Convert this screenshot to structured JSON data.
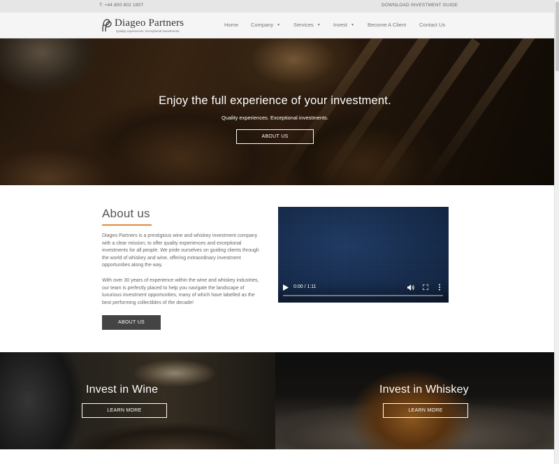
{
  "topbar": {
    "phone": "T: +44 800 802 1907",
    "guide_link": "DOWNLOAD INVESTMENT GUIDE"
  },
  "header": {
    "logo_name": "Diageo Partners",
    "logo_tagline": "Quality experiences. Exceptional investments.",
    "nav": [
      {
        "label": "Home",
        "has_dropdown": false
      },
      {
        "label": "Company",
        "has_dropdown": true
      },
      {
        "label": "Services",
        "has_dropdown": true
      },
      {
        "label": "Invest",
        "has_dropdown": true
      },
      {
        "label": "Become A Client",
        "has_dropdown": false
      },
      {
        "label": "Contact Us",
        "has_dropdown": false
      }
    ],
    "caret": "▼"
  },
  "hero": {
    "title": "Enjoy the full experience of your investment.",
    "subtitle": "Quality experiences. Exceptional investments.",
    "button": "ABOUT US"
  },
  "about": {
    "title": "About us",
    "paragraph1": "Diageo Partners is a prestigious wine and whiskey investment company with a clear mission; to offer quality experiences and exceptional investments for all people. We pride ourselves on guiding clients through the world of whiskey and wine, offering extraordinary investment opportunities along the way.",
    "paragraph2": "With over 30 years of experience within the wine and whiskey industries, our team is perfectly placed to help you navigate the landscape of luxurious investment opportunities, many of which have labelled as the best performing collectibles of the decade!",
    "button": "ABOUT US",
    "accent_color": "#e08a3a"
  },
  "video": {
    "time": "0:00 / 1:11",
    "progress": 0
  },
  "panels": {
    "wine": {
      "title": "Invest in Wine",
      "button": "LEARN MORE"
    },
    "whiskey": {
      "title": "Invest in Whiskey",
      "button": "LEARN MORE"
    }
  }
}
